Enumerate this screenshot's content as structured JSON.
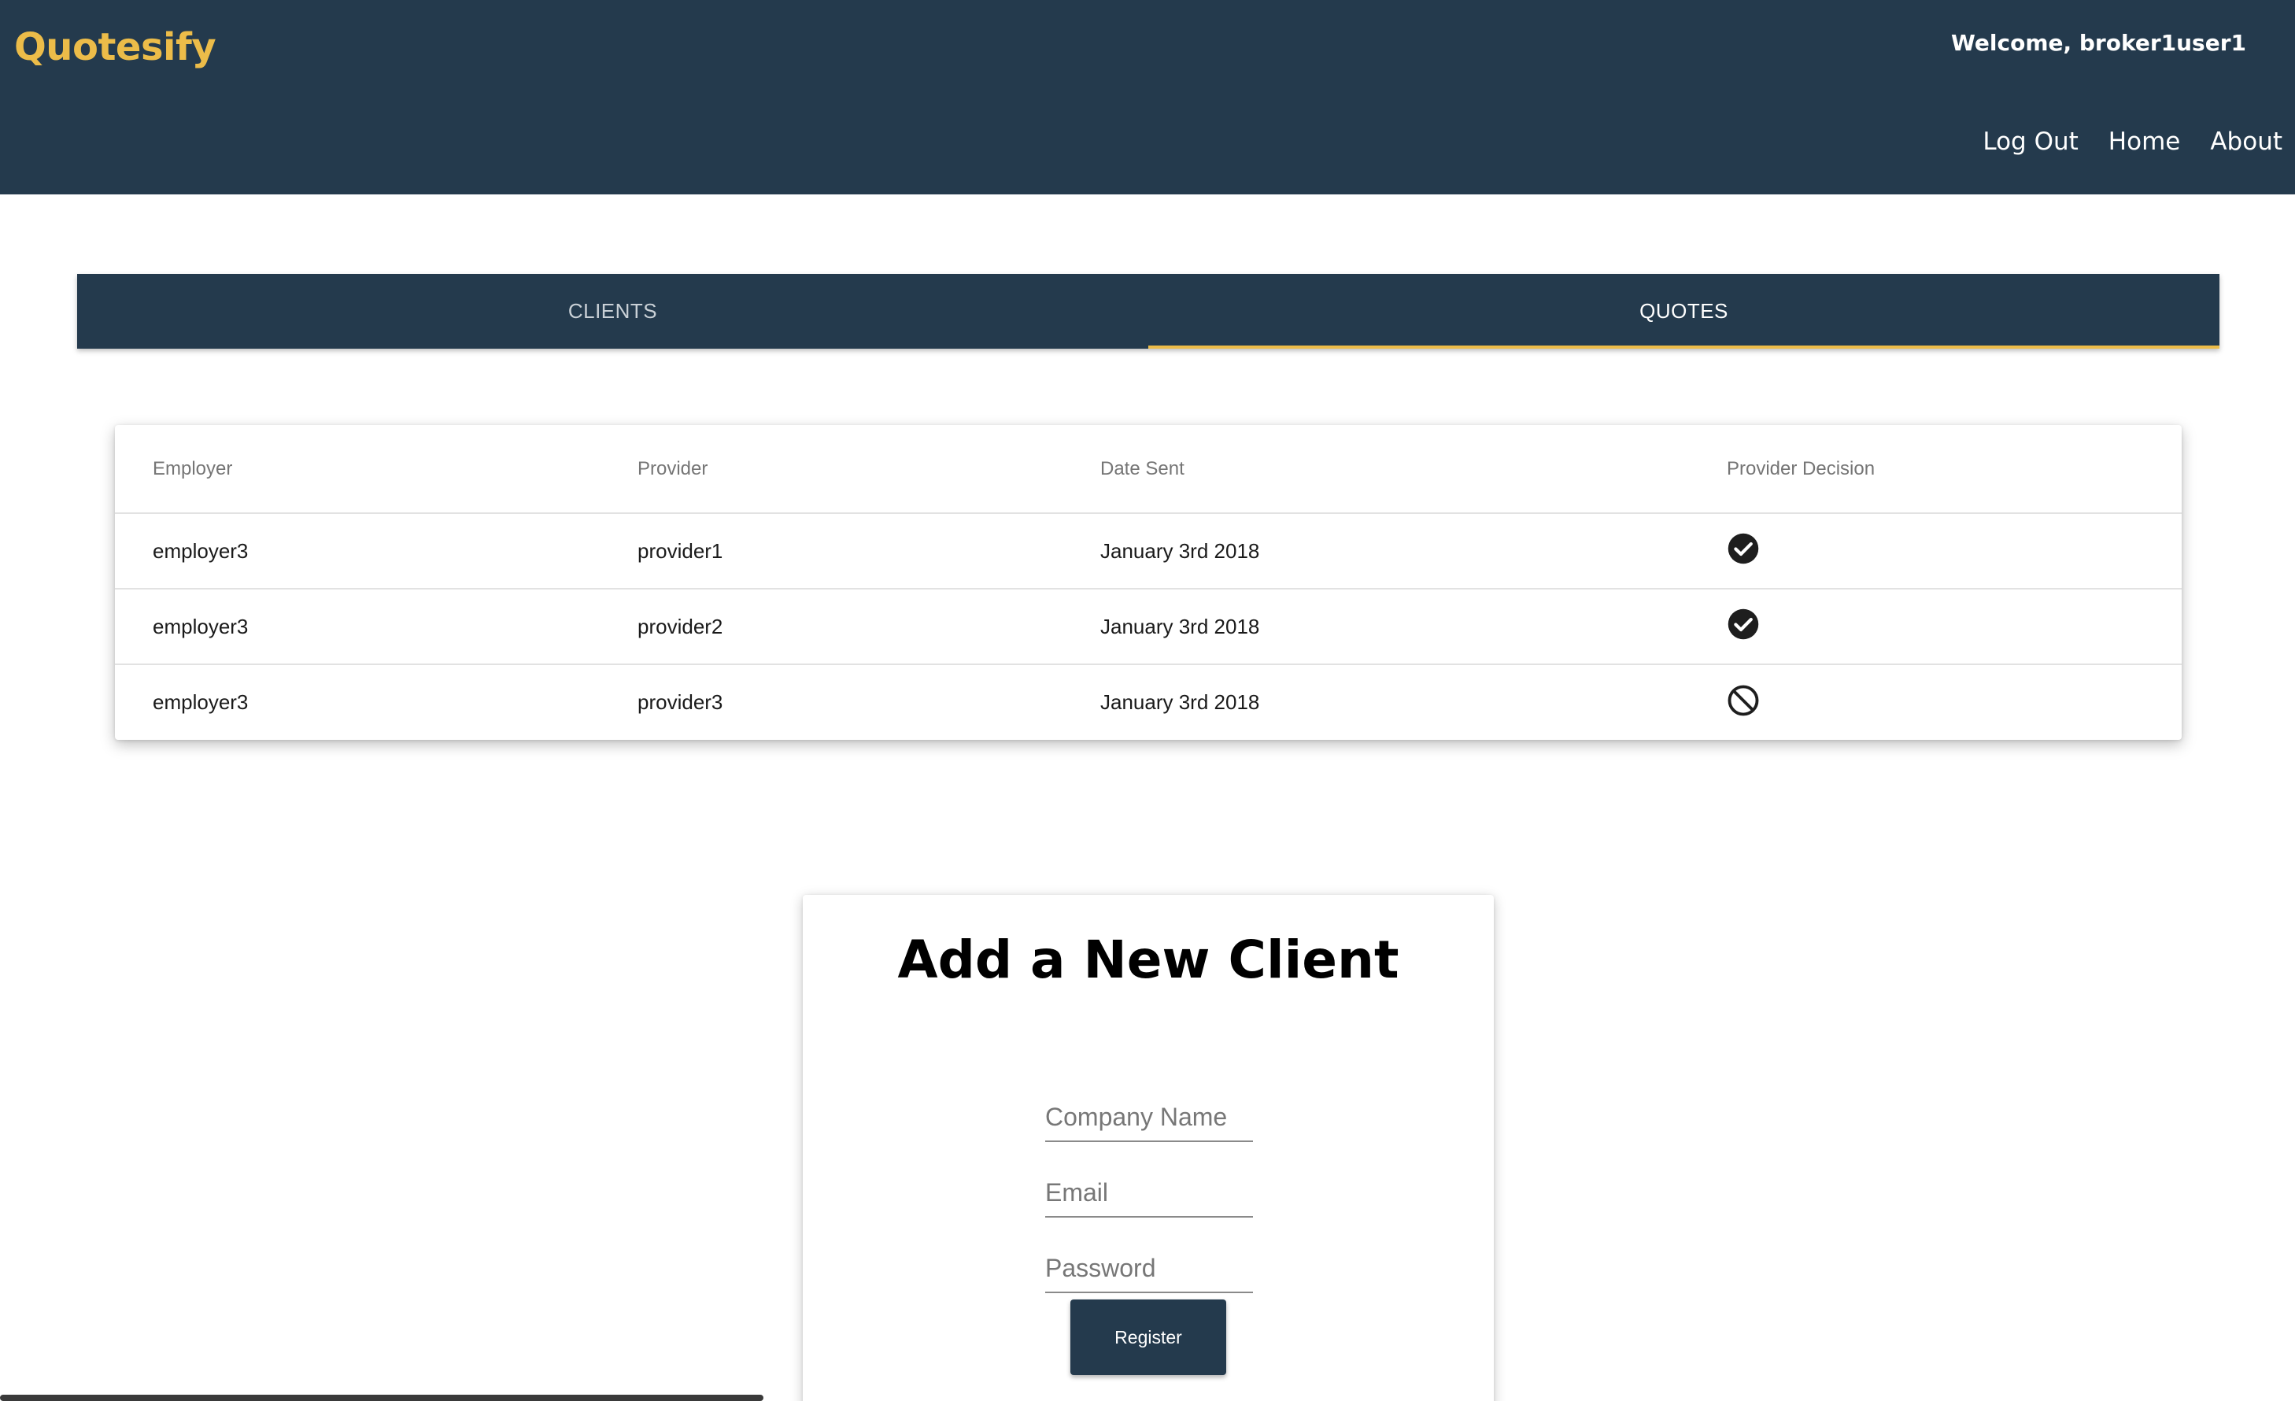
{
  "header": {
    "brand": "Quotesify",
    "welcome": "Welcome, broker1user1",
    "nav": {
      "logout": "Log Out",
      "home": "Home",
      "about": "About"
    }
  },
  "tabs": {
    "clients": "CLIENTS",
    "quotes": "QUOTES",
    "active": "QUOTES"
  },
  "table": {
    "headers": {
      "employer": "Employer",
      "provider": "Provider",
      "date_sent": "Date Sent",
      "decision": "Provider Decision"
    },
    "rows": [
      {
        "employer": "employer3",
        "provider": "provider1",
        "date_sent": "January 3rd 2018",
        "decision_icon": "check-circle-icon"
      },
      {
        "employer": "employer3",
        "provider": "provider2",
        "date_sent": "January 3rd 2018",
        "decision_icon": "check-circle-icon"
      },
      {
        "employer": "employer3",
        "provider": "provider3",
        "date_sent": "January 3rd 2018",
        "decision_icon": "block-icon"
      }
    ]
  },
  "form": {
    "title": "Add a New Client",
    "company_placeholder": "Company Name",
    "email_placeholder": "Email",
    "password_placeholder": "Password",
    "register_label": "Register"
  },
  "colors": {
    "primary": "#243a4d",
    "accent": "#ecbc49"
  }
}
